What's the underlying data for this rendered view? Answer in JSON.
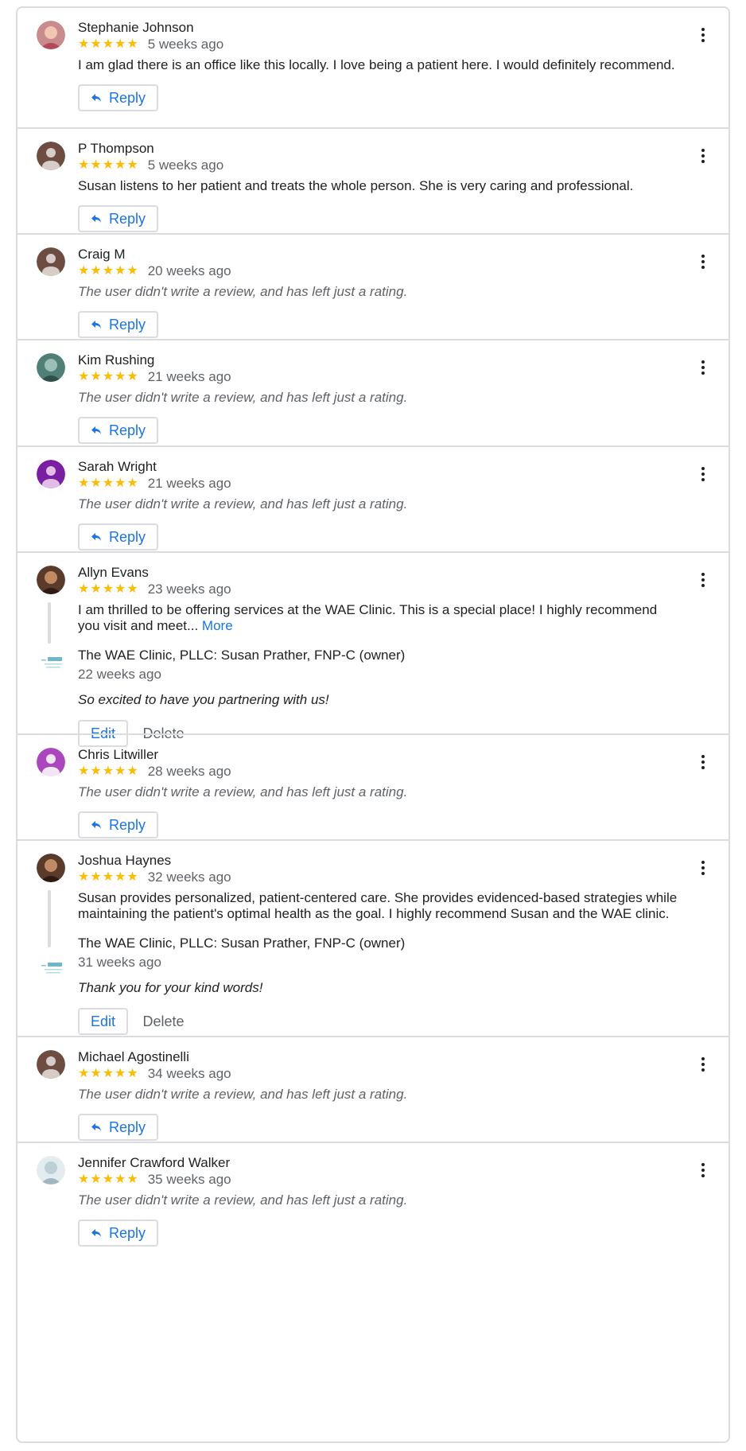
{
  "reviews": [
    {
      "name": "Stephanie Johnson",
      "stars": "★★★★★",
      "when": "5 weeks ago",
      "text": "I am glad there is an office like this locally. I love being a patient here. I would definitely recommend.",
      "avatar": "photo-pink"
    },
    {
      "name": "P Thompson",
      "stars": "★★★★★",
      "when": "5 weeks ago",
      "text": "Susan listens to her patient and treats the whole person. She is very caring and professional.",
      "avatar": "default-brown"
    },
    {
      "name": "Craig M",
      "stars": "★★★★★",
      "when": "20 weeks ago",
      "text": "The user didn't write a review, and has left just a rating.",
      "avatar": "default-brown"
    },
    {
      "name": "Kim Rushing",
      "stars": "★★★★★",
      "when": "21 weeks ago",
      "text": "The user didn't write a review, and has left just a rating.",
      "avatar": "photo-teal"
    },
    {
      "name": "Sarah Wright",
      "stars": "★★★★★",
      "when": "21 weeks ago",
      "text": "The user didn't write a review, and has left just a rating.",
      "avatar": "default-purple"
    },
    {
      "name": "Allyn Evans",
      "stars": "★★★★★",
      "when": "23 weeks ago",
      "text": "I am thrilled to be offering services at the WAE Clinic. This is a special place! I highly recommend you visit and meet...",
      "more": "More",
      "avatar": "photo-dark",
      "owner": {
        "name": "The WAE Clinic, PLLC: Susan Prather, FNP-C (owner)",
        "when": "22 weeks ago",
        "reply": "So excited to have you partnering with us!"
      }
    },
    {
      "name": "Chris Litwiller",
      "stars": "★★★★★",
      "when": "28 weeks ago",
      "text": "The user didn't write a review, and has left just a rating.",
      "avatar": "default-violet"
    },
    {
      "name": "Joshua Haynes",
      "stars": "★★★★★",
      "when": "32 weeks ago",
      "text": "Susan provides personalized, patient-centered care. She provides evidenced-based strategies while maintaining the patient's optimal health as the goal. I highly recommend Susan and the WAE clinic.",
      "avatar": "photo-dark",
      "owner": {
        "name": "The WAE Clinic, PLLC: Susan Prather, FNP-C (owner)",
        "when": "31 weeks ago",
        "reply": "Thank you for your kind words!"
      }
    },
    {
      "name": "Michael Agostinelli",
      "stars": "★★★★★",
      "when": "34 weeks ago",
      "text": "The user didn't write a review, and has left just a rating.",
      "avatar": "default-brown"
    },
    {
      "name": "Jennifer Crawford Walker",
      "stars": "★★★★★",
      "when": "35 weeks ago",
      "text": "The user didn't write a review, and has left just a rating.",
      "avatar": "photo-light"
    }
  ],
  "labels": {
    "reply": "Reply",
    "edit": "Edit",
    "delete": "Delete"
  },
  "colors": {
    "accent": "#1a73e8",
    "star": "#fbbc04",
    "border": "#dadce0",
    "secondary_text": "#5f6368"
  }
}
